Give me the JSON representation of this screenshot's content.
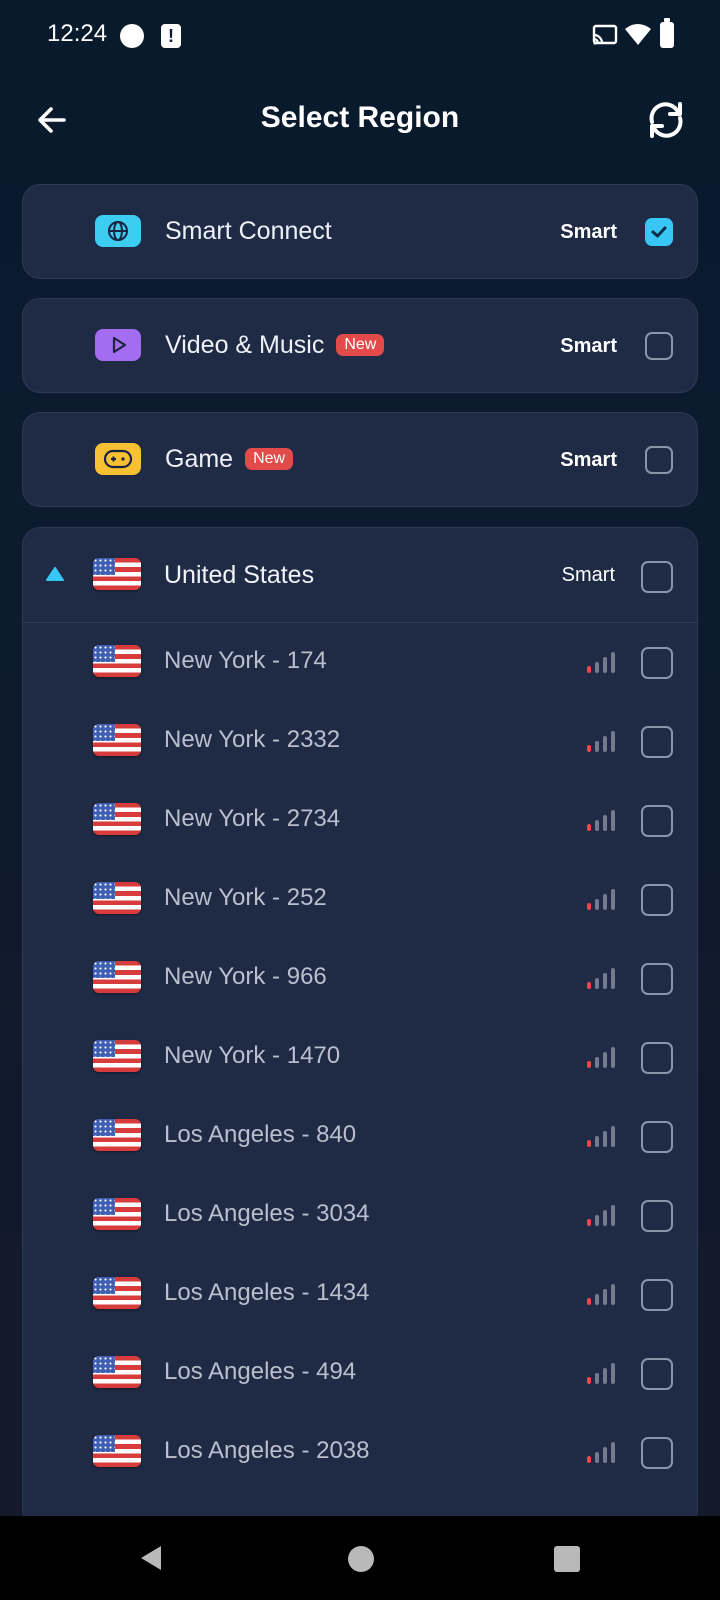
{
  "status_bar": {
    "time": "12:24",
    "alert_glyph": "!"
  },
  "header": {
    "title": "Select Region"
  },
  "categories": [
    {
      "label": "Smart Connect",
      "icon": "globe-icon",
      "icon_color": "#3ccdf0",
      "new": false,
      "mode": "Smart",
      "checked": true
    },
    {
      "label": "Video & Music",
      "icon": "play-icon",
      "icon_color": "#a46cf0",
      "new": true,
      "new_label": "New",
      "mode": "Smart",
      "checked": false
    },
    {
      "label": "Game",
      "icon": "gamepad-icon",
      "icon_color": "#f7c133",
      "new": true,
      "new_label": "New",
      "mode": "Smart",
      "checked": false
    }
  ],
  "region": {
    "name": "United States",
    "mode": "Smart",
    "checked": false,
    "servers": [
      {
        "name": "New York - 174"
      },
      {
        "name": "New York - 2332"
      },
      {
        "name": "New York - 2734"
      },
      {
        "name": "New York - 252"
      },
      {
        "name": "New York - 966"
      },
      {
        "name": "New York - 1470"
      },
      {
        "name": "Los Angeles - 840"
      },
      {
        "name": "Los Angeles - 3034"
      },
      {
        "name": "Los Angeles - 1434"
      },
      {
        "name": "Los Angeles - 494"
      },
      {
        "name": "Los Angeles - 2038"
      }
    ]
  },
  "colors": {
    "accent": "#38c6f4",
    "badge": "#e34a4a",
    "card": "#1f2a45",
    "signal_active": "#e84848"
  }
}
